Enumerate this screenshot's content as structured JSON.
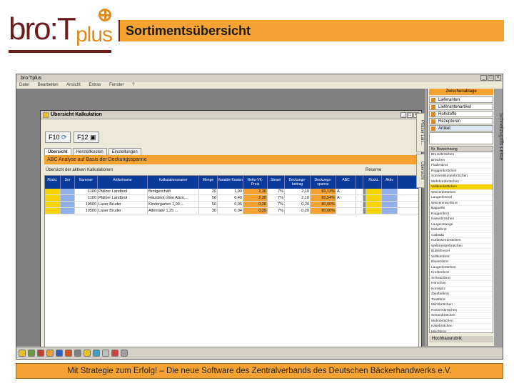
{
  "logo": {
    "text_main": "bro:T",
    "text_plus": "plus"
  },
  "header": {
    "title": "Sortimentsübersicht"
  },
  "app": {
    "title": "bro:Tplus",
    "menu": [
      "Datei",
      "Bearbeiten",
      "Ansicht",
      "Extras",
      "Fenster",
      "?"
    ],
    "inner_title": "Übersicht Kalkulation",
    "f10": "F10",
    "f12": "F12",
    "tabs": [
      "Übersicht",
      "Herstellkosten",
      "Einstellungen"
    ],
    "abc_bar": "ABC Analyse auf Basis der Deckungsspanne",
    "table_title": "Übersicht der aktiven Kalkulationen",
    "reserve_title": "Reserve",
    "columns": [
      "Rückt.",
      "Sor",
      "Nummer",
      "Artikelname",
      "Kalkulationsname",
      "Menge",
      "Variable Kosten",
      "Netto-VK-Preis",
      "Steuer",
      "Deckungs-beitrag",
      "Deckungs-spanne",
      "ABC",
      "",
      "Rückt.",
      "Aktiv"
    ],
    "rows": [
      {
        "nr": "1100",
        "art": "Pfälzer Landbrot",
        "kalk": "Brotgeschäft",
        "menge": "20",
        "vk": "1,00",
        "netto": "2,30",
        "st": "7%",
        "db": "2,10",
        "ds": "65,13%",
        "abc": "A"
      },
      {
        "nr": "1100",
        "art": "Pfälzer Landbrot",
        "kalk": "Hausbrot ohne Abzu...",
        "menge": "50",
        "vk": "0,40",
        "netto": "2,30",
        "st": "7%",
        "db": "2,10",
        "ds": "65,54%",
        "abc": "A"
      },
      {
        "nr": "10500",
        "art": "Laser Bruder",
        "kalk": "Kindergarten 1,00 ...",
        "menge": "50",
        "vk": "0,06",
        "netto": "0,26",
        "st": "7%",
        "db": "0,20",
        "ds": "80,00%",
        "abc": ""
      },
      {
        "nr": "10500",
        "art": "Laser Bruder",
        "kalk": "Alternativ 1,25 ...",
        "menge": "30",
        "vk": "0,04",
        "netto": "0,26",
        "st": "7%",
        "db": "0,20",
        "ds": "80,00%",
        "abc": ""
      }
    ],
    "right": {
      "zwischenablage": "Zwischenablage",
      "nav": [
        "Lieferanten",
        "Lieferantenartikel",
        "Rohstoffe",
        "Rezepturen",
        "Artikel"
      ],
      "list_header": "Nr. Bezeichnung",
      "articles": [
        "Brezelbrötchen",
        "Brötchen",
        "Fladenbrot",
        "Roggenbrötchen",
        "Sonnenblumenbrötchen",
        "Mehrkornbrötchen",
        "Vollkornbrötchen",
        "Weizenbrötchen",
        "Laugenbrezel",
        "Weizenmischbrot",
        "Baguette",
        "Roggenbrot",
        "Kaiserbrötchen",
        "Laugenstange",
        "Dinkelbrot",
        "Ciabatta",
        "Kürbiskernbrötchen",
        "Weltmeisterbrötchen",
        "Butterbrezel",
        "Vollkornbrot",
        "Bauernbrot",
        "Laugenbrötchen",
        "Krustenbrot",
        "Schwarzbrot",
        "Hörnchen",
        "Kornspitz",
        "Zwiebelbrot",
        "Toastbrot",
        "Milchbrötchen",
        "Rosinenbrötchen",
        "Sesambrötchen",
        "Mohnbrötchen",
        "Käsebrötchen",
        "Mischbrot",
        "Speckbrot",
        "Nussbrot",
        "Früchtebrot",
        "Kartoffelbrot",
        "Schrotbrot",
        "Körnerbrot",
        "Roggenmischbrot",
        "Dinkelbrötchen",
        "Vollkornbrezel",
        "Bauernbrötchen",
        "Laugenecke"
      ],
      "bottom": "Hochhausrubrik"
    },
    "vtabs": [
      "Pfälzer Lan...",
      "Übersicht"
    ],
    "schnell": "Schnellzugriffs-Leiste"
  },
  "footer": {
    "text": "Mit Strategie zum Erfolg! – Die neue Software des Zentralverbands des Deutschen Bäckerhandwerks e.V."
  },
  "colors": {
    "orange": "#f5a233",
    "brown": "#6b1c1c",
    "grid_header": "#0a3a9a",
    "yellow": "#f5d400"
  }
}
